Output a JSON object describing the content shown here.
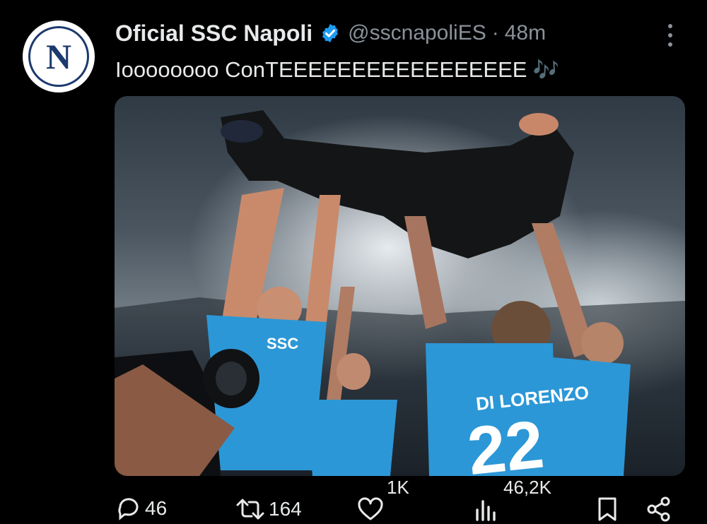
{
  "post": {
    "display_name": "Oficial SSC Napoli",
    "handle": "@sscnapoliES",
    "separator": "·",
    "time_ago": "48m",
    "avatar_letter": "N",
    "text": "Ioooooooo ConTEEEEEEEEEEEEEEEEE",
    "emoji": "🎶",
    "media_jersey_name": "DI LORENZO",
    "media_jersey_number": "22",
    "media_badge_text": "SSC"
  },
  "actions": {
    "replies": "46",
    "reposts": "164",
    "likes": "1K",
    "views": "46,2K"
  },
  "colors": {
    "background": "#000000",
    "text": "#e7e9ea",
    "muted": "#8b9199",
    "verified": "#1d9bf0",
    "jersey": "#2c97d6"
  },
  "icons": {
    "verified": "verified-badge-icon",
    "more": "more-vertical-icon",
    "reply": "reply-icon",
    "repost": "repost-icon",
    "like": "heart-icon",
    "views": "views-chart-icon",
    "bookmark": "bookmark-icon",
    "share": "share-icon"
  }
}
